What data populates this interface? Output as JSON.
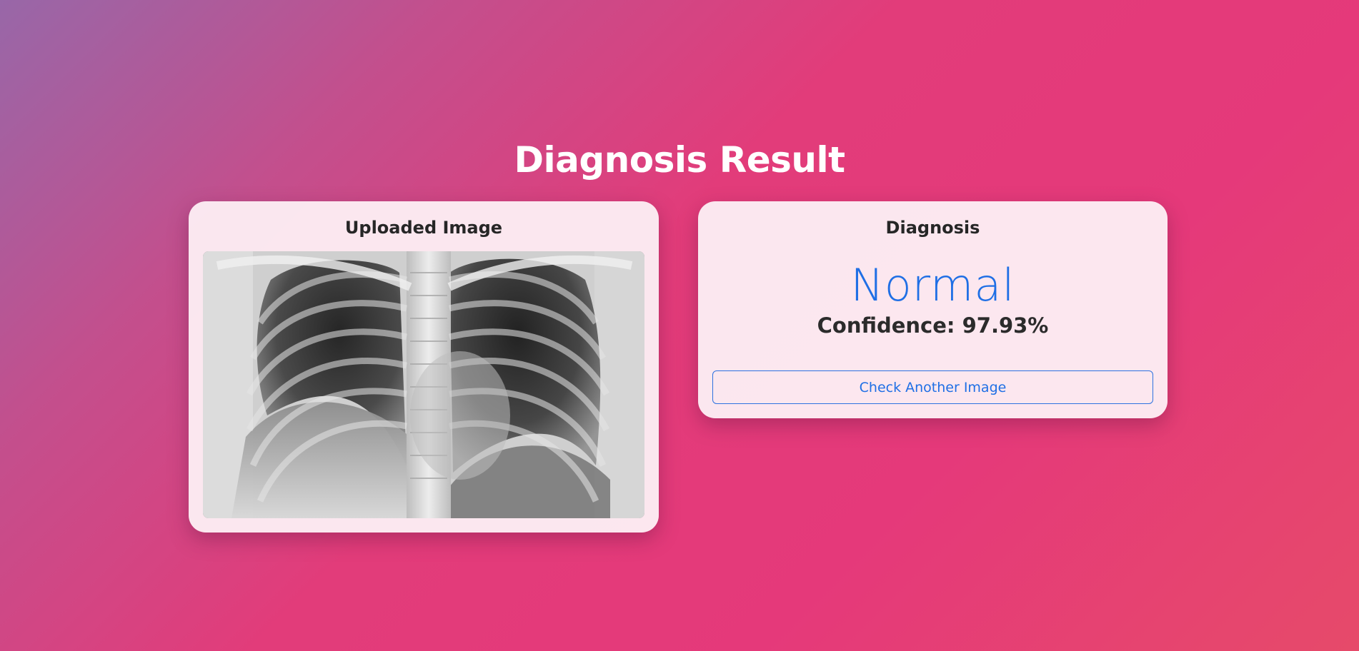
{
  "page": {
    "title": "Diagnosis Result"
  },
  "uploaded_card": {
    "heading": "Uploaded Image",
    "image_alt": "chest x-ray"
  },
  "diagnosis_card": {
    "heading": "Diagnosis",
    "result": "Normal",
    "confidence_text": "Confidence: 97.93%",
    "button_label": "Check Another Image"
  },
  "colors": {
    "result_text": "#1f6fe5",
    "button_border": "#2d72e0",
    "title_text": "#ffffff"
  }
}
